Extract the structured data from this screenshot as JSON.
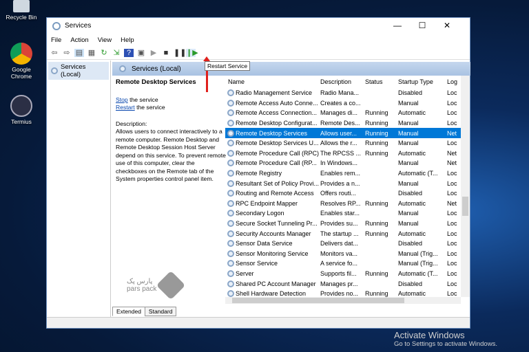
{
  "desktop": {
    "icons": [
      {
        "label": "Recycle Bin"
      },
      {
        "label": "Google Chrome"
      },
      {
        "label": "Termius"
      }
    ],
    "activation": {
      "title": "Activate Windows",
      "subtitle": "Go to Settings to activate Windows."
    },
    "watermark": "پارس پک pars pack"
  },
  "window": {
    "title": "Services",
    "menu": [
      "File",
      "Action",
      "View",
      "Help"
    ],
    "tooltip": "Restart Service",
    "tree_item": "Services (Local)",
    "pane_header": "Services (Local)",
    "details": {
      "title": "Remote Desktop Services",
      "stop_link": "Stop",
      "stop_rest": " the service",
      "restart_link": "Restart",
      "restart_rest": " the service",
      "description": "Description:\nAllows users to connect interactively to a remote computer. Remote Desktop and Remote Desktop Session Host Server depend on this service. To prevent remote use of this computer, clear the checkboxes on the Remote tab of the System properties control panel item."
    },
    "columns": [
      "Name",
      "Description",
      "Status",
      "Startup Type",
      "Log"
    ],
    "rows": [
      [
        "Radio Management Service",
        "Radio Mana...",
        "",
        "Disabled",
        "Loc"
      ],
      [
        "Remote Access Auto Conne...",
        "Creates a co...",
        "",
        "Manual",
        "Loc"
      ],
      [
        "Remote Access Connection...",
        "Manages di...",
        "Running",
        "Automatic",
        "Loc"
      ],
      [
        "Remote Desktop Configurat...",
        "Remote Des...",
        "Running",
        "Manual",
        "Loc"
      ],
      [
        "Remote Desktop Services",
        "Allows user...",
        "Running",
        "Manual",
        "Net"
      ],
      [
        "Remote Desktop Services U...",
        "Allows the r...",
        "Running",
        "Manual",
        "Loc"
      ],
      [
        "Remote Procedure Call (RPC)",
        "The RPCSS ...",
        "Running",
        "Automatic",
        "Net"
      ],
      [
        "Remote Procedure Call (RP...",
        "In Windows...",
        "",
        "Manual",
        "Net"
      ],
      [
        "Remote Registry",
        "Enables rem...",
        "",
        "Automatic (T...",
        "Loc"
      ],
      [
        "Resultant Set of Policy Provi...",
        "Provides a n...",
        "",
        "Manual",
        "Loc"
      ],
      [
        "Routing and Remote Access",
        "Offers routi...",
        "",
        "Disabled",
        "Loc"
      ],
      [
        "RPC Endpoint Mapper",
        "Resolves RP...",
        "Running",
        "Automatic",
        "Net"
      ],
      [
        "Secondary Logon",
        "Enables star...",
        "",
        "Manual",
        "Loc"
      ],
      [
        "Secure Socket Tunneling Pr...",
        "Provides su...",
        "Running",
        "Manual",
        "Loc"
      ],
      [
        "Security Accounts Manager",
        "The startup ...",
        "Running",
        "Automatic",
        "Loc"
      ],
      [
        "Sensor Data Service",
        "Delivers dat...",
        "",
        "Disabled",
        "Loc"
      ],
      [
        "Sensor Monitoring Service",
        "Monitors va...",
        "",
        "Manual (Trig...",
        "Loc"
      ],
      [
        "Sensor Service",
        "A service fo...",
        "",
        "Manual (Trig...",
        "Loc"
      ],
      [
        "Server",
        "Supports fil...",
        "Running",
        "Automatic (T...",
        "Loc"
      ],
      [
        "Shared PC Account Manager",
        "Manages pr...",
        "",
        "Disabled",
        "Loc"
      ],
      [
        "Shell Hardware Detection",
        "Provides no...",
        "Running",
        "Automatic",
        "Loc"
      ]
    ],
    "selected_index": 4,
    "tabs": [
      "Extended",
      "Standard"
    ]
  }
}
